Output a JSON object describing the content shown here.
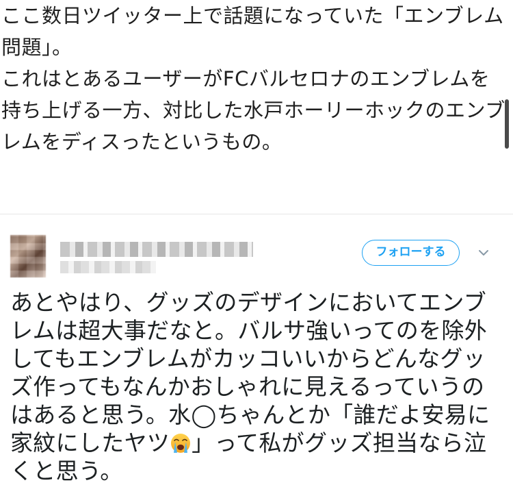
{
  "article": {
    "paragraph1": "ここ数日ツイッター上で話題になっていた「エンブレム問題」。",
    "paragraph2": "これはとあるユーザーがFCバルセロナのエンブレムを持ち上げる一方、対比した水戸ホーリーホックのエンブレムをディスったというもの。"
  },
  "tweet": {
    "follow_label": "フォローする",
    "text_part1": "あとやはり、グッズのデザインにおいてエンブレムは超大事だなと。バルサ強いってのを除外してもエンブレムがカッコいいからどんなグッズ作ってもなんかおしゃれに見えるっていうのはあると思う。水◯ちゃんとか「誰だよ安易に家紋にしたヤツ",
    "emoji": "loudly-crying-face-icon",
    "text_part2": "」って私がグッズ担当なら泣くと思う。"
  },
  "colors": {
    "follow_accent": "#1da1f2",
    "body_text": "#1c2022"
  }
}
